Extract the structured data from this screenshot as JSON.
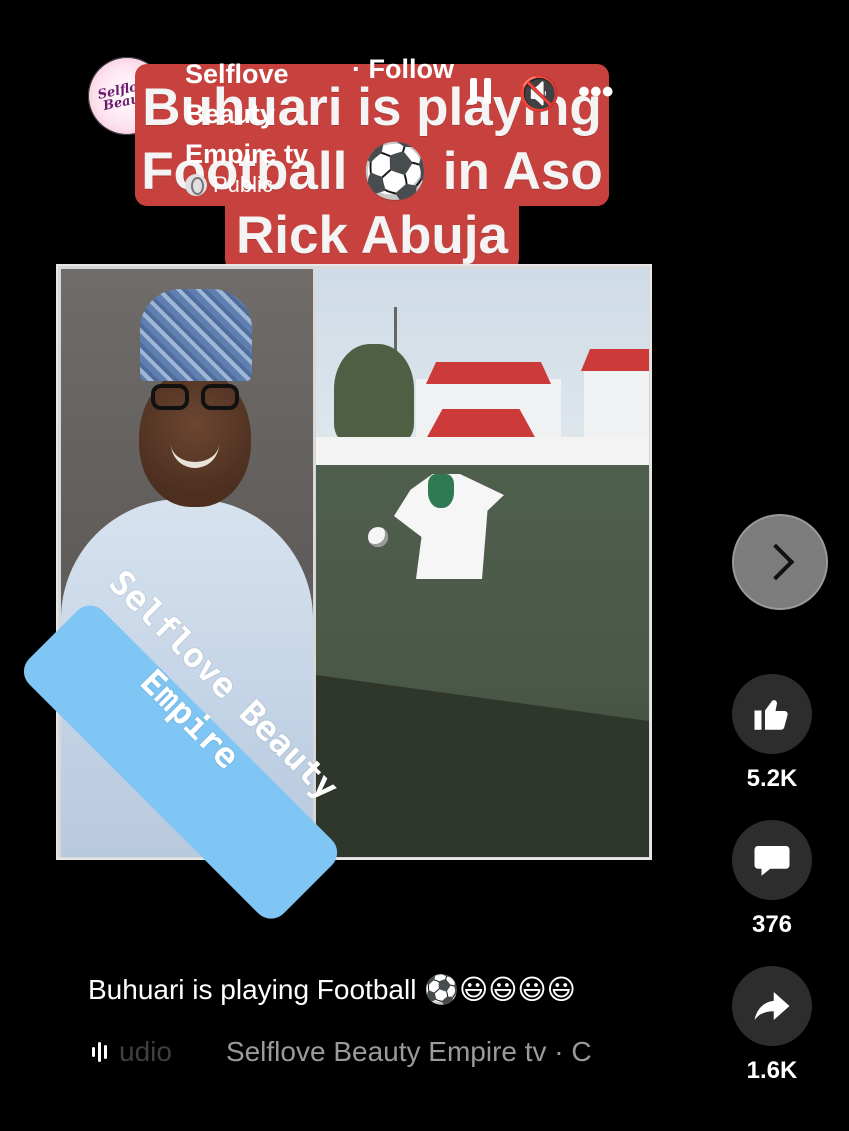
{
  "post": {
    "author": "Selflove Beauty Empire tv",
    "follow_label": "· Follow",
    "visibility": "Public",
    "avatar_text": "Selflove Beauty"
  },
  "overlay_title": {
    "line1": "Buhuari is playing",
    "line2": "Football ⚽ in Aso",
    "line3": "Rick Abuja"
  },
  "controls": {
    "pause": "pause-icon",
    "mute_glyph": "🔇",
    "more_glyph": "•••"
  },
  "watermark": "Selflove Beauty Empire",
  "actions": {
    "like_count": "5.2K",
    "comment_count": "376",
    "share_count": "1.6K"
  },
  "caption": "Buhuari is playing Football ⚽😃😃😃😃",
  "audio": {
    "faded_label": "udio",
    "source": "Selflove Beauty Empire tv · C"
  },
  "colors": {
    "title_bg": "#c7423e",
    "watermark_bg": "#7fc6f4",
    "action_bg": "#2d2d2d"
  }
}
